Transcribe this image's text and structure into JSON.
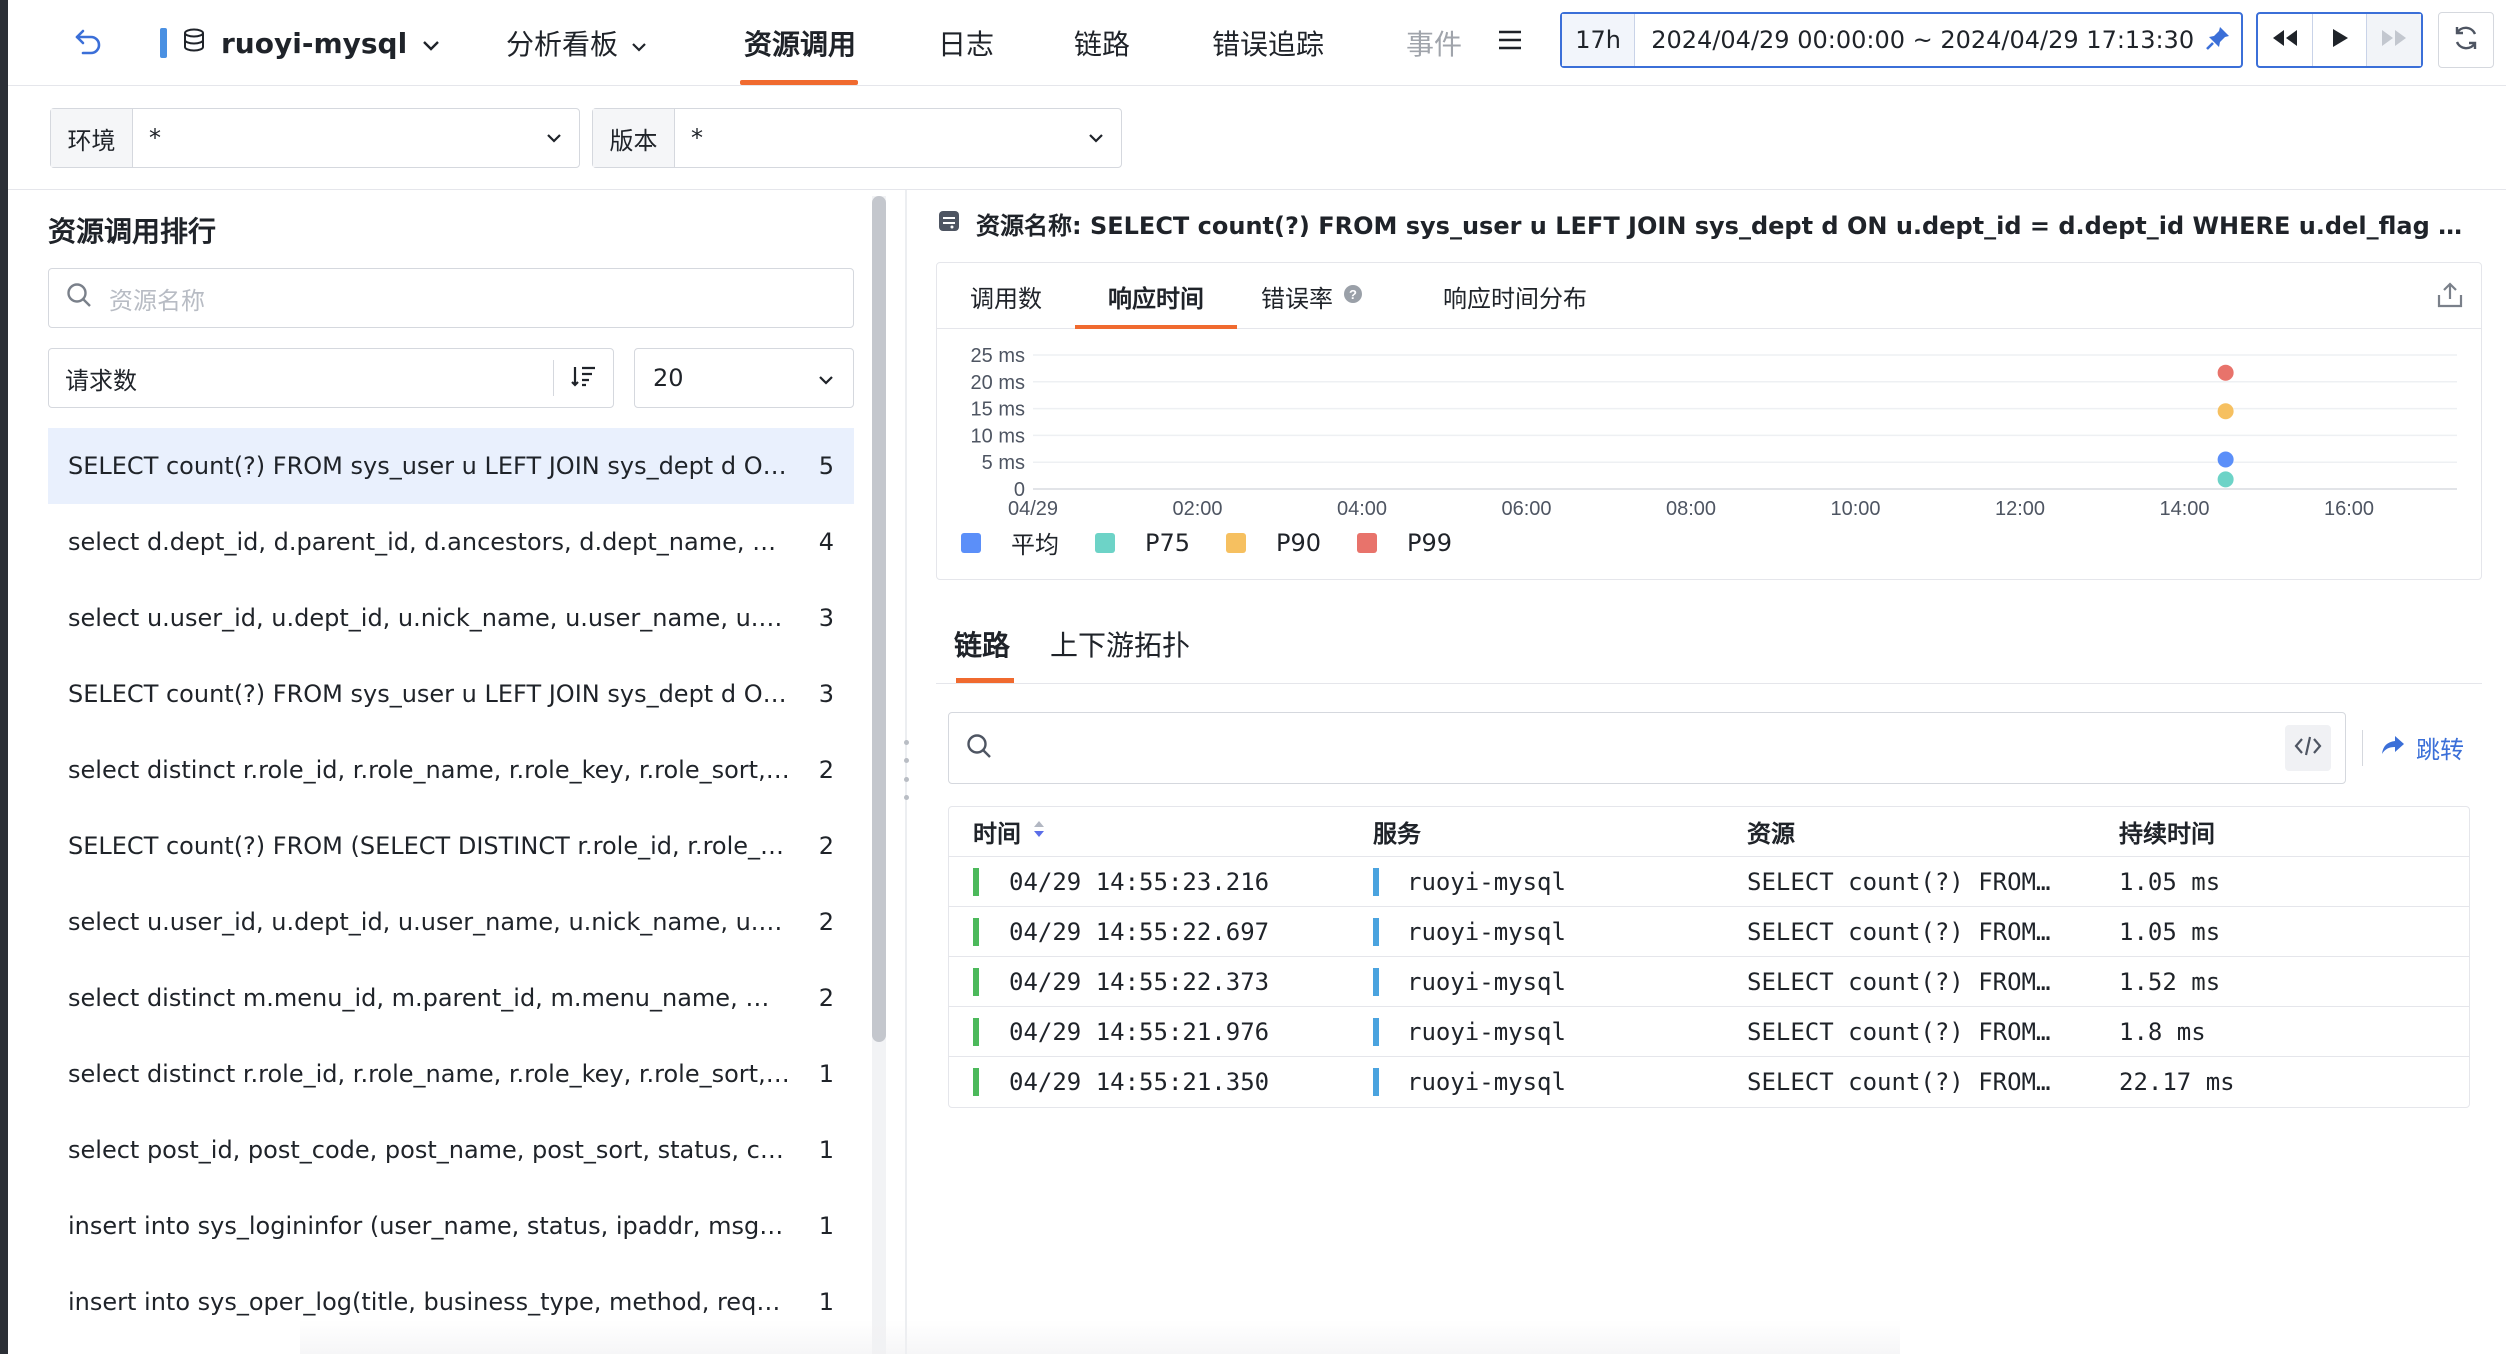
{
  "header": {
    "app_name": "ruoyi-mysql",
    "nav": [
      {
        "label": "分析看板"
      },
      {
        "label": "资源调用"
      },
      {
        "label": "日志"
      },
      {
        "label": "链路"
      },
      {
        "label": "错误追踪"
      },
      {
        "label": "事件"
      }
    ],
    "time_short": "17h",
    "time_range": "2024/04/29 00:00:00 ~ 2024/04/29 17:13:30"
  },
  "filters": {
    "env_label": "环境",
    "env_value": "*",
    "version_label": "版本",
    "version_value": "*"
  },
  "left": {
    "title": "资源调用排行",
    "search_placeholder": "资源名称",
    "sort_label": "请求数",
    "count_value": "20",
    "items": [
      {
        "text": "SELECT count(?) FROM sys_user u LEFT JOIN sys_dept d ON u.dept_id = d.dept_id",
        "count": "5"
      },
      {
        "text": "select d.dept_id, d.parent_id, d.ancestors, d.dept_name, d.order_num",
        "count": "4"
      },
      {
        "text": "select u.user_id, u.dept_id, u.nick_name, u.user_name, u.email",
        "count": "3"
      },
      {
        "text": "SELECT count(?) FROM sys_user u LEFT JOIN sys_dept d ON u.dept_id = d.dept_id",
        "count": "3"
      },
      {
        "text": "select distinct r.role_id, r.role_name, r.role_key, r.role_sort, r.data_scope",
        "count": "2"
      },
      {
        "text": "SELECT count(?) FROM (SELECT DISTINCT r.role_id, r.role_name",
        "count": "2"
      },
      {
        "text": "select u.user_id, u.dept_id, u.user_name, u.nick_name, u.email",
        "count": "2"
      },
      {
        "text": "select distinct m.menu_id, m.parent_id, m.menu_name, m.path",
        "count": "2"
      },
      {
        "text": "select distinct r.role_id, r.role_name, r.role_key, r.role_sort, r.data_scope",
        "count": "1"
      },
      {
        "text": "select post_id, post_code, post_name, post_sort, status, create_by",
        "count": "1"
      },
      {
        "text": "insert into sys_logininfor (user_name, status, ipaddr, msg, access_time)",
        "count": "1"
      },
      {
        "text": "insert into sys_oper_log(title, business_type, method, request_method)",
        "count": "1"
      }
    ]
  },
  "right": {
    "resource_title": "资源名称: SELECT count(?) FROM sys_user u LEFT JOIN sys_dept d ON u.dept_id = d.dept_id WHERE u.del_flag = ? AND (u.status = ?)",
    "chart_tabs": [
      "调用数",
      "响应时间",
      "错误率",
      "响应时间分布"
    ],
    "sub_tabs": [
      "链路",
      "上下游拓扑"
    ],
    "jump_label": "跳转",
    "table": {
      "headers": [
        "时间",
        "服务",
        "资源",
        "持续时间"
      ],
      "rows": [
        {
          "time": "04/29 14:55:23.216",
          "service": "ruoyi-mysql",
          "resource": "SELECT count(?) FROM sys_user",
          "duration": "1.05 ms"
        },
        {
          "time": "04/29 14:55:22.697",
          "service": "ruoyi-mysql",
          "resource": "SELECT count(?) FROM sys_user",
          "duration": "1.05 ms"
        },
        {
          "time": "04/29 14:55:22.373",
          "service": "ruoyi-mysql",
          "resource": "SELECT count(?) FROM sys_user",
          "duration": "1.52 ms"
        },
        {
          "time": "04/29 14:55:21.976",
          "service": "ruoyi-mysql",
          "resource": "SELECT count(?) FROM sys_user",
          "duration": "1.8 ms"
        },
        {
          "time": "04/29 14:55:21.350",
          "service": "ruoyi-mysql",
          "resource": "SELECT count(?) FROM sys_user",
          "duration": "22.17 ms"
        }
      ]
    }
  },
  "chart_data": {
    "type": "scatter",
    "y_tick_labels": [
      "0",
      "5 ms",
      "10 ms",
      "15 ms",
      "20 ms",
      "25 ms"
    ],
    "x_tick_labels": [
      "04/29",
      "02:00",
      "04:00",
      "06:00",
      "08:00",
      "10:00",
      "12:00",
      "14:00",
      "16:00"
    ],
    "x_range_hours": [
      0,
      17.2
    ],
    "ylim": [
      0,
      25
    ],
    "grid": true,
    "legend_position": "bottom-left",
    "series": [
      {
        "name": "平均",
        "color": "#5b8ff9",
        "points": [
          {
            "x_hour": 14.5,
            "y": 5.5
          }
        ]
      },
      {
        "name": "P75",
        "color": "#6dd3c7",
        "points": [
          {
            "x_hour": 14.5,
            "y": 1.8
          }
        ]
      },
      {
        "name": "P90",
        "color": "#f6c060",
        "points": [
          {
            "x_hour": 14.5,
            "y": 14.5
          }
        ]
      },
      {
        "name": "P99",
        "color": "#e8736b",
        "points": [
          {
            "x_hour": 14.5,
            "y": 21.7
          }
        ]
      }
    ]
  }
}
